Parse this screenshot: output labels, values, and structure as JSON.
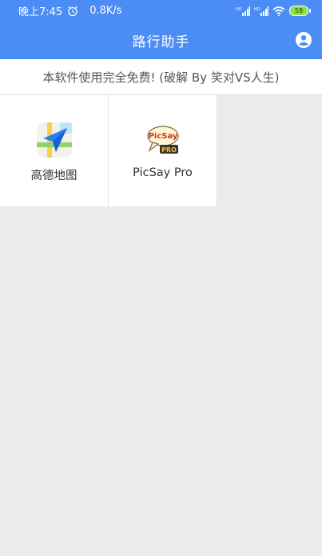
{
  "status_bar": {
    "time": "晚上7:45",
    "alarm_icon": "alarm-clock-icon",
    "network_speed": "0.8K/s",
    "signal_icons": [
      "hd-signal-icon",
      "hd-signal-icon"
    ],
    "wifi_icon": "wifi-icon",
    "battery_level": "58"
  },
  "app_bar": {
    "title": "路行助手",
    "account_icon": "account-circle-icon"
  },
  "notice": {
    "text": "本软件使用完全免费! (破解 By 笑对VS人生)"
  },
  "apps": [
    {
      "label": "高德地图",
      "icon": "amap-navigation-icon"
    },
    {
      "label": "PicSay Pro",
      "icon": "picsay-pro-icon",
      "icon_text_top": "PicSay",
      "icon_text_bottom": "PRO"
    }
  ],
  "colors": {
    "accent": "#4c8cf5",
    "background": "#ececec",
    "tile": "#ffffff"
  }
}
